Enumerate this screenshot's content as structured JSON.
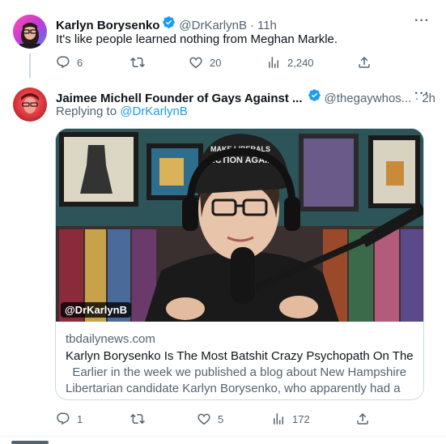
{
  "tweet1": {
    "name": "Karlyn Borysenko",
    "handle": "@DrKarlynB",
    "dot": "·",
    "time": "11h",
    "more": "···",
    "text": "It's like people learned nothing from Meghan Markle.",
    "replies": "6",
    "retweets": "",
    "likes": "20",
    "views": "2,240"
  },
  "tweet2": {
    "name": "Jaimee Michell Founder of Gays Against ...",
    "handle": "@thegaywhos...",
    "dot": "·",
    "time": "2h",
    "more": "···",
    "replying_prefix": "Replying to ",
    "replying_to": "@DrKarlynB",
    "card": {
      "media_tag": "@DrKarlynB",
      "hat_text_1": "MAKE LIBERALS",
      "hat_text_2": "FICTION AGAIN",
      "domain": "tbdailynews.com",
      "title": "Karlyn Borysenko Is The Most Batshit Crazy Psychopath On The Inte...",
      "description_line1": "  Earlier in the week we published a blog about New Hampshire",
      "description_line2": "Libertarian candidate Karlyn Borysenko, who apparently had a long ..."
    },
    "replies": "1",
    "retweets": "",
    "likes": "5",
    "views": "172"
  },
  "colors": {
    "accent": "#1d9bf0",
    "secondary_text": "#536471",
    "primary_text": "#0f1419",
    "border": "#cfd9de"
  },
  "icons": [
    "verified-badge-icon",
    "more-icon",
    "reply-icon",
    "retweet-icon",
    "like-icon",
    "views-icon",
    "share-icon"
  ]
}
